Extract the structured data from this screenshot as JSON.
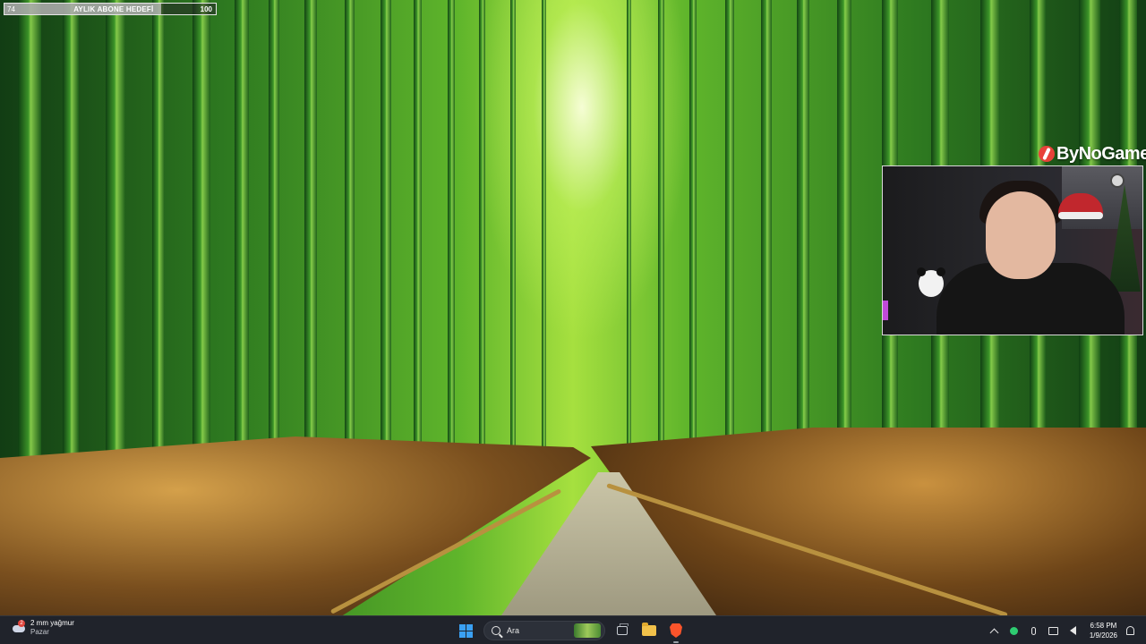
{
  "overlay": {
    "goal": {
      "current": "74",
      "label": "AYLIK ABONE HEDEFİ",
      "target": "100",
      "progress": 0.74
    },
    "brand": {
      "name": "ByNoGame"
    }
  },
  "taskbar": {
    "weather": {
      "main": "2 mm yağmur",
      "sub": "Pazar",
      "badge": "2",
      "icon": "rain-cloud-icon"
    },
    "start": {
      "icon": "windows-icon"
    },
    "search": {
      "placeholder": "Ara",
      "icon": "search-icon"
    },
    "apps": [
      {
        "name": "task-view",
        "icon": "task-view-icon"
      },
      {
        "name": "file-explorer",
        "icon": "folder-icon"
      },
      {
        "name": "brave-browser",
        "icon": "brave-icon"
      }
    ],
    "tray": {
      "icons": [
        "chevron-up-icon",
        "status-dot-icon",
        "microphone-icon",
        "network-icon",
        "volume-icon",
        "notification-icon"
      ],
      "accent": "#2ecc71",
      "time": "6:58 PM",
      "date": "1/9/2026"
    }
  }
}
